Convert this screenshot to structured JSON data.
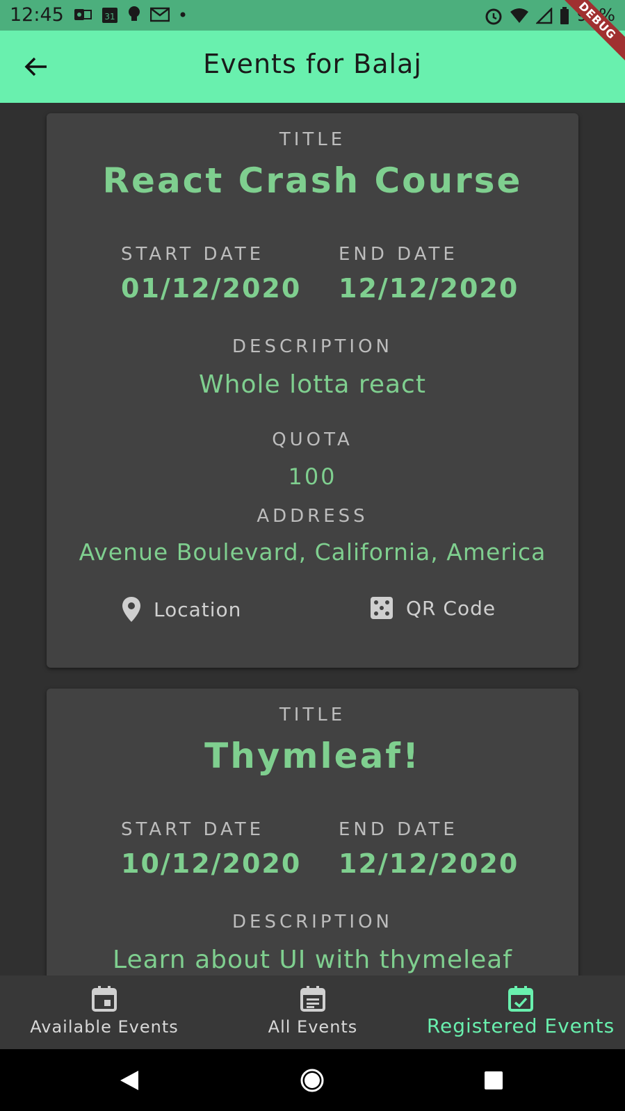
{
  "status_bar": {
    "time": "12:45",
    "battery": "99%",
    "left_icons": [
      "outlook-icon",
      "calendar-icon",
      "lightbulb-icon",
      "mail-icon",
      "dot-icon"
    ],
    "right_icons": [
      "alarm-icon",
      "wifi-icon",
      "cell-signal-icon",
      "battery-icon"
    ],
    "calendar_day": "31"
  },
  "debug_banner": "DEBUG",
  "app_bar": {
    "title": "Events for Balaj",
    "back_icon": "arrow-back-icon"
  },
  "events": [
    {
      "title_label": "TITLE",
      "title": "React Crash Course",
      "start_label": "START DATE",
      "start_date": "01/12/2020",
      "end_label": "END DATE",
      "end_date": "12/12/2020",
      "description_label": "DESCRIPTION",
      "description": "Whole lotta react",
      "quota_label": "QUOTA",
      "quota": "100",
      "address_label": "ADDRESS",
      "address": "Avenue Boulevard, California, America",
      "location_label": "Location",
      "qr_label": "QR Code"
    },
    {
      "title_label": "TITLE",
      "title": "Thymleaf!",
      "start_label": "START DATE",
      "start_date": "10/12/2020",
      "end_label": "END DATE",
      "end_date": "12/12/2020",
      "description_label": "DESCRIPTION",
      "description": "Learn about UI with thymeleaf"
    }
  ],
  "bottom_nav": {
    "items": [
      {
        "label": "Available Events",
        "icon": "calendar-today-icon"
      },
      {
        "label": "All Events",
        "icon": "event-note-icon"
      },
      {
        "label": "Registered Events",
        "icon": "event-available-icon"
      }
    ],
    "active_index": 2
  },
  "colors": {
    "accent": "#69f0ae",
    "value_green": "#7fcf8f",
    "card_bg": "#424242",
    "page_bg": "#303030",
    "status_bar_bg": "#4caf7d"
  }
}
